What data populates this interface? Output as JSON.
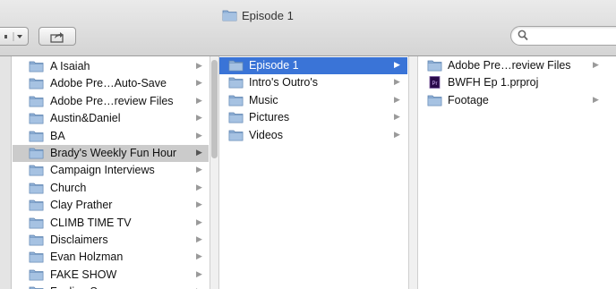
{
  "window": {
    "title": "Episode 1"
  },
  "toolbar": {
    "search_placeholder": ""
  },
  "columns": [
    {
      "items": [
        {
          "label": "A Isaiah"
        },
        {
          "label": "Adobe Pre…Auto-Save"
        },
        {
          "label": "Adobe Pre…review Files"
        },
        {
          "label": "Austin&Daniel"
        },
        {
          "label": "BA"
        },
        {
          "label": "Brady's Weekly Fun Hour",
          "state": "highlight"
        },
        {
          "label": "Campaign Interviews"
        },
        {
          "label": "Church"
        },
        {
          "label": "Clay Prather"
        },
        {
          "label": "CLIMB TIME TV"
        },
        {
          "label": "Disclaimers"
        },
        {
          "label": "Evan Holzman"
        },
        {
          "label": "FAKE SHOW"
        },
        {
          "label": "Feeling S…"
        }
      ]
    },
    {
      "items": [
        {
          "label": "Episode 1",
          "state": "selected"
        },
        {
          "label": "Intro's Outro's"
        },
        {
          "label": "Music"
        },
        {
          "label": "Pictures"
        },
        {
          "label": "Videos"
        }
      ]
    },
    {
      "items": [
        {
          "label": "Adobe Pre…review Files",
          "kind": "folder"
        },
        {
          "label": "BWFH Ep 1.prproj",
          "kind": "file",
          "icon_text": "Pr"
        },
        {
          "label": "Footage",
          "kind": "folder"
        }
      ]
    }
  ],
  "colors": {
    "selection": "#3a74d7",
    "highlight": "#cbcbcb",
    "folder": "#8fb0d6",
    "premiere": "#2a0a4a"
  }
}
